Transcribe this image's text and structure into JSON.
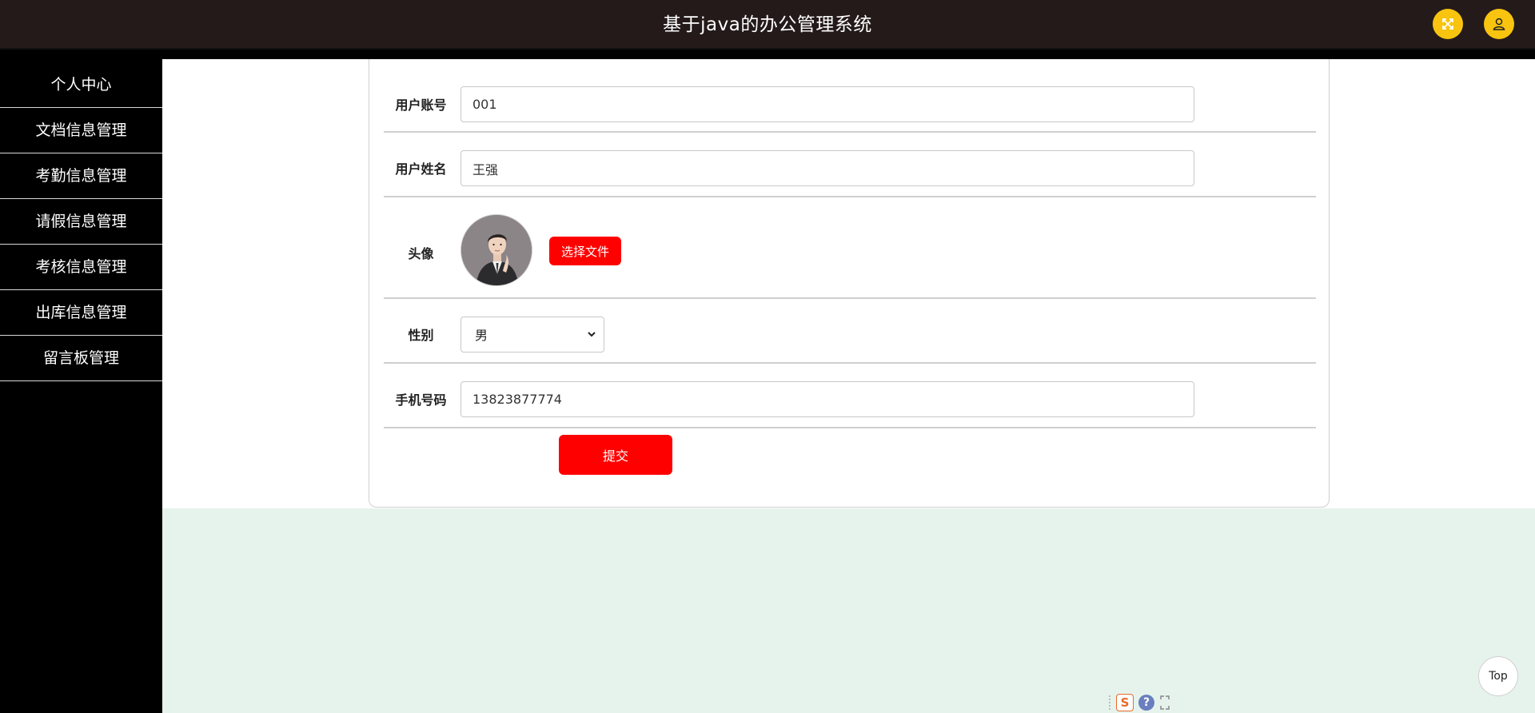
{
  "header": {
    "title": "基于java的办公管理系统",
    "fullscreen_icon": "fullscreen-icon",
    "user_icon": "user-icon",
    "accent_color": "#f8c40f"
  },
  "sidebar": {
    "items": [
      {
        "label": "个人中心"
      },
      {
        "label": "文档信息管理"
      },
      {
        "label": "考勤信息管理"
      },
      {
        "label": "请假信息管理"
      },
      {
        "label": "考核信息管理"
      },
      {
        "label": "出库信息管理"
      },
      {
        "label": "留言板管理"
      }
    ]
  },
  "form": {
    "account": {
      "label": "用户账号",
      "value": "001"
    },
    "name": {
      "label": "用户姓名",
      "value": "王强"
    },
    "avatar": {
      "label": "头像",
      "choose_label": "选择文件"
    },
    "gender": {
      "label": "性别",
      "selected": "男"
    },
    "phone": {
      "label": "手机号码",
      "value": "13823877774"
    },
    "submit_label": "提交",
    "button_color": "#ff0000"
  },
  "widgets": {
    "tray_s": "S",
    "tray_help": "?",
    "top_label": "Top"
  }
}
